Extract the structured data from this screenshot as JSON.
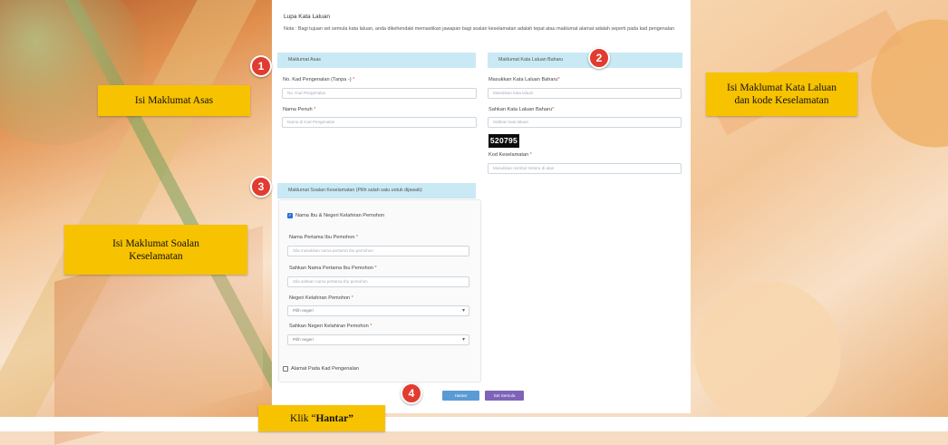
{
  "form": {
    "title": "Lupa Kata Laluan",
    "note": "Nota : Bagi tujuan set semula kata laluan, anda dikehendaki memastikan jawapan bagi soalan keselamatan adalah tepat atau maklumat alamat adalah seperti pada kad pengenalan",
    "section_asas": "Maklumat Asas",
    "section_kata_laluan": "Maklumat Kata Laluan Baharu",
    "section_soalan": "Maklumat Soalan Keselamatan (Pilih salah satu untuk dijawab)",
    "ic_label": "No. Kad Pengenalan (Tanpa -)",
    "ic_placeholder": "No. Kad Pengenalan",
    "name_label": "Nama Penuh",
    "name_placeholder": "Nama di Kad Pengenalan",
    "new_pw_label": "Masukkan Kata Laluan Baharu",
    "new_pw_placeholder": "Masukkan kata laluan",
    "confirm_pw_label": "Sahkan Kata Laluan Baharu",
    "confirm_pw_placeholder": "Sahkan kata laluan",
    "captcha_code": "520795",
    "security_code_label": "Kod Keselamatan",
    "security_code_placeholder": "Masukkan nombor tertera di atas",
    "option_ibu_negeri": "Nama Ibu & Negeri Kelahiran Pemohon",
    "option_ibu_negeri_checked": true,
    "mother_name_label": "Nama Pertama Ibu Pemohon",
    "mother_name_placeholder": "Sila masukkan nama pertama Ibu pemohon",
    "confirm_mother_label": "Sahkan Nama Pertama Ibu Pemohon",
    "confirm_mother_placeholder": "Sila sahkan nama pertama Ibu pemohon",
    "state_label": "Negeri Kelahiran Pemohon",
    "state_value": "Pilih negeri",
    "confirm_state_label": "Sahkan Negeri Kelahiran Pemohon",
    "confirm_state_value": "Pilih negeri",
    "option_alamat": "Alamat Pada Kad Pengenalan",
    "option_alamat_checked": false,
    "required_mark": "*",
    "submit_button": "Hantar",
    "reset_button": "Set Semula"
  },
  "markers": [
    "1",
    "2",
    "3",
    "4"
  ],
  "callouts": {
    "asas": "Isi Maklumat Asas",
    "kata_laluan_line1": "Isi Maklumat Kata Laluan",
    "kata_laluan_line2": "dan kode Keselamatan",
    "soalan_line1": "Isi Maklumat Soalan",
    "soalan_line2": "Keselamatan",
    "hantar_prefix": "Klik “",
    "hantar_bold": "Hantar”"
  },
  "colors": {
    "callout": "#f7c200",
    "marker": "#e23b2f",
    "section_header": "#c9e9f5",
    "submit": "#5b9bd5",
    "reset": "#7e64b8"
  }
}
